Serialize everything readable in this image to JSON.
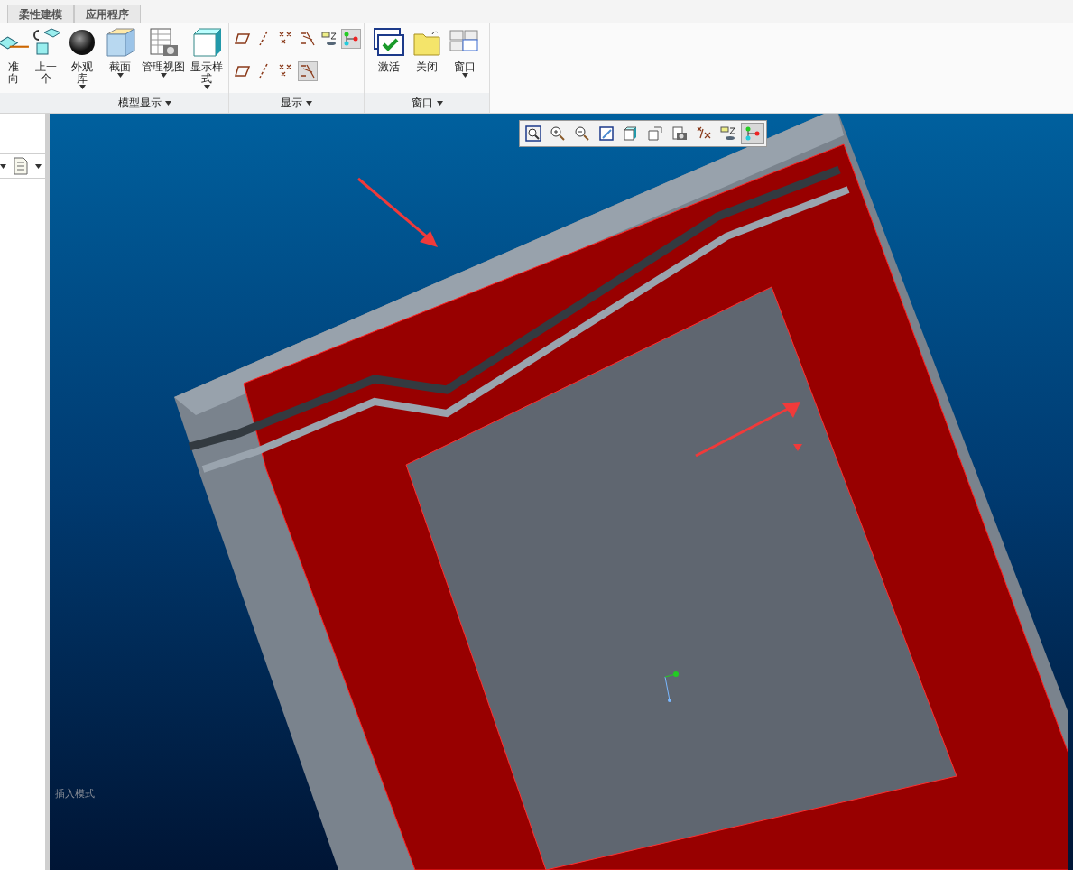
{
  "ribbon_tabs": [
    {
      "label": "柔性建模",
      "selected": false
    },
    {
      "label": "应用程序",
      "selected": false
    }
  ],
  "ribbon_groups": [
    {
      "kind": "large",
      "buttons": [
        {
          "kind": "orient",
          "lines": [
            "准",
            "向"
          ],
          "dropdown": false
        },
        {
          "kind": "previous",
          "lines": [
            "上一",
            "个"
          ],
          "dropdown": false
        }
      ]
    },
    {
      "kind": "large",
      "label": "模型显示",
      "buttons": [
        {
          "kind": "appearance",
          "lines": [
            "外观",
            "库"
          ],
          "dropdown": true
        },
        {
          "kind": "section",
          "lines": [
            "截面"
          ],
          "dropdown": true
        },
        {
          "kind": "views",
          "lines": [
            "管理视图"
          ],
          "dropdown": true
        },
        {
          "kind": "style",
          "lines": [
            "显示样",
            "式"
          ],
          "dropdown": true
        }
      ]
    },
    {
      "kind": "toggles",
      "label": "显示",
      "rows": [
        [
          {
            "kind": "plane",
            "selected": false
          },
          {
            "kind": "axis",
            "selected": false
          },
          {
            "kind": "point",
            "selected": false
          },
          {
            "kind": "csys",
            "selected": false
          },
          {
            "kind": "annotation",
            "selected": false
          },
          {
            "kind": "spin",
            "selected": true
          }
        ],
        [
          {
            "kind": "plane",
            "selected": false
          },
          {
            "kind": "axis",
            "selected": false
          },
          {
            "kind": "point",
            "selected": false
          },
          {
            "kind": "csys",
            "selected": true
          }
        ]
      ]
    },
    {
      "kind": "large",
      "label": "窗口",
      "buttons": [
        {
          "kind": "activate",
          "lines": [
            "激活"
          ],
          "dropdown": false
        },
        {
          "kind": "close",
          "lines": [
            "关闭"
          ],
          "dropdown": false
        },
        {
          "kind": "windows",
          "lines": [
            "窗口"
          ],
          "dropdown": true
        }
      ]
    }
  ],
  "view_toolbar": [
    {
      "kind": "refit",
      "selected": false
    },
    {
      "kind": "zoom-in",
      "selected": false
    },
    {
      "kind": "zoom-out",
      "selected": false
    },
    {
      "kind": "repaint",
      "selected": false
    },
    {
      "kind": "style",
      "selected": false
    },
    {
      "kind": "views",
      "selected": false
    },
    {
      "kind": "camera",
      "selected": false
    },
    {
      "kind": "datum",
      "selected": false
    },
    {
      "kind": "annotation",
      "selected": false
    },
    {
      "kind": "spin",
      "selected": true
    }
  ],
  "viewport": {
    "status": "插入模式"
  }
}
